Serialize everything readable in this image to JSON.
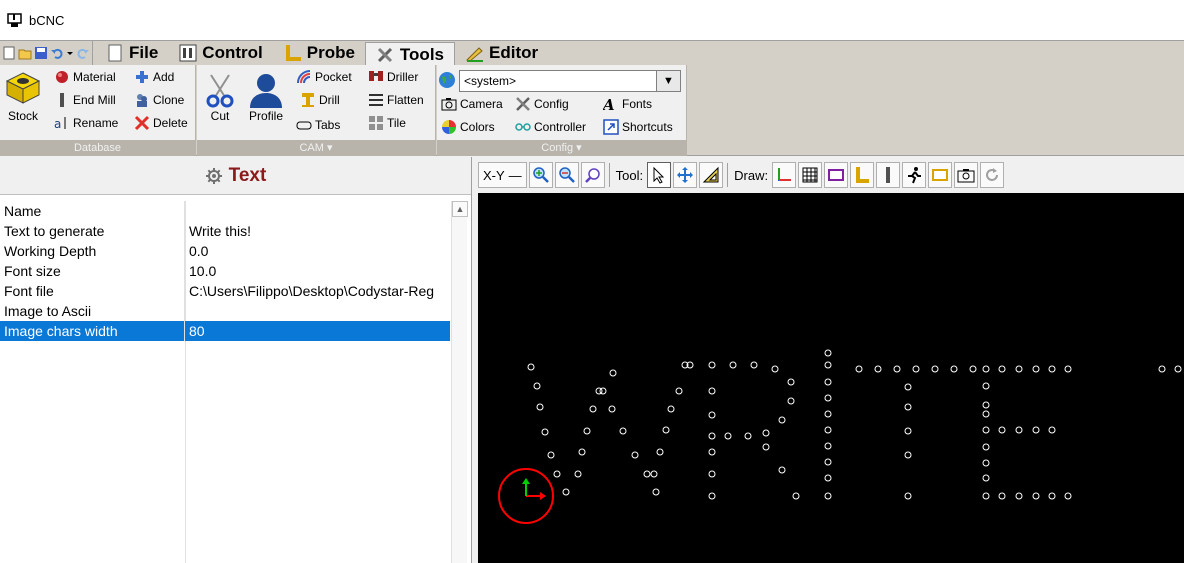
{
  "window": {
    "title": "bCNC"
  },
  "tabs": [
    {
      "label": "File",
      "icon": "file-icon"
    },
    {
      "label": "Control",
      "icon": "control-icon"
    },
    {
      "label": "Probe",
      "icon": "probe-icon"
    },
    {
      "label": "Tools",
      "icon": "tools-icon",
      "active": true
    },
    {
      "label": "Editor",
      "icon": "editor-icon"
    }
  ],
  "ribbon": {
    "database": {
      "footer": "Database",
      "stock": "Stock",
      "material": "Material",
      "end_mill": "End Mill",
      "rename": "Rename",
      "add": "Add",
      "clone": "Clone",
      "delete": "Delete"
    },
    "cam": {
      "footer": "CAM",
      "cut": "Cut",
      "profile": "Profile",
      "pocket": "Pocket",
      "drill": "Drill",
      "tabs": "Tabs",
      "driller": "Driller",
      "flatten": "Flatten",
      "tile": "Tile"
    },
    "config": {
      "footer": "Config",
      "combo_value": "<system>",
      "camera": "Camera",
      "config": "Config",
      "fonts": "Fonts",
      "colors": "Colors",
      "controller": "Controller",
      "shortcuts": "Shortcuts"
    }
  },
  "panel": {
    "title": "Text",
    "properties": [
      {
        "key": "Name",
        "value": ""
      },
      {
        "key": "Text to generate",
        "value": "Write this!"
      },
      {
        "key": "Working Depth",
        "value": "0.0"
      },
      {
        "key": "Font size",
        "value": "10.0"
      },
      {
        "key": "Font file",
        "value": "C:\\Users\\Filippo\\Desktop\\Codystar-Reg"
      },
      {
        "key": "Image to Ascii",
        "value": ""
      },
      {
        "key": "Image chars width",
        "value": "80",
        "selected": true
      }
    ]
  },
  "canvas_toolbar": {
    "view": "X-Y",
    "tool_label": "Tool:",
    "draw_label": "Draw:"
  },
  "colors": {
    "selection": "#0a78d7",
    "panel_title": "#8b1a1a",
    "canvas_bg": "#000000",
    "origin_circle": "#ff0000"
  }
}
